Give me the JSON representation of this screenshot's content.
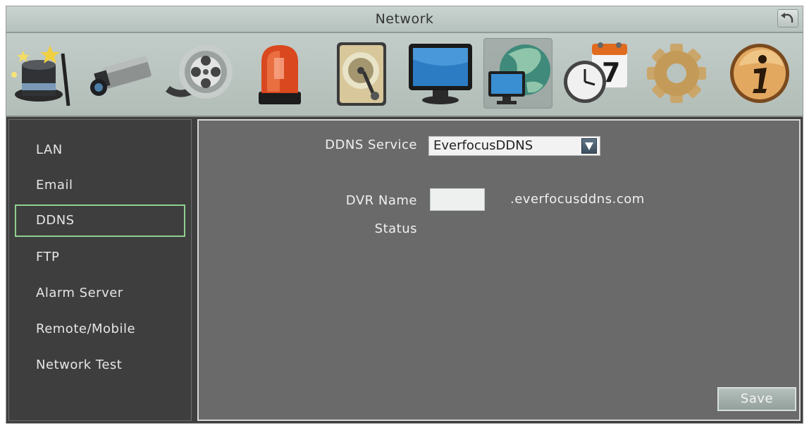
{
  "window": {
    "title": "Network"
  },
  "toolbar": {
    "icons": [
      "magic-wizard-icon",
      "camera-icon",
      "film-reel-icon",
      "alarm-light-icon",
      "hard-disk-icon",
      "monitor-icon",
      "network-globe-icon",
      "schedule-calendar-icon",
      "settings-gear-icon",
      "info-icon"
    ],
    "active_icon": "network-globe-icon"
  },
  "sidebar": {
    "items": [
      {
        "label": "LAN"
      },
      {
        "label": "Email"
      },
      {
        "label": "DDNS",
        "selected": true
      },
      {
        "label": "FTP"
      },
      {
        "label": "Alarm Server"
      },
      {
        "label": "Remote/Mobile"
      },
      {
        "label": "Network Test"
      }
    ]
  },
  "ddns": {
    "service_label": "DDNS Service",
    "service_value": "EverfocusDDNS",
    "dvr_name_label": "DVR Name",
    "dvr_name_value": "",
    "domain_suffix": ".everfocusddns.com",
    "status_label": "Status",
    "status_value": ""
  },
  "actions": {
    "save_label": "Save"
  },
  "colors": {
    "panel": "#6a6a6a",
    "sidebar": "#3e3e3e",
    "selection_border": "#8fd08e",
    "title_bar": "#c2ccc8"
  }
}
